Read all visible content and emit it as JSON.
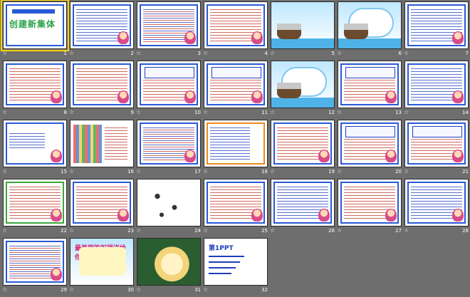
{
  "slides": [
    {
      "num": "1",
      "style": "title",
      "text": "创建新集体"
    },
    {
      "num": "2",
      "style": "text-blue"
    },
    {
      "num": "3",
      "style": "text-mix"
    },
    {
      "num": "4",
      "style": "text-red"
    },
    {
      "num": "5",
      "style": "ship"
    },
    {
      "num": "6",
      "style": "ship-cloud"
    },
    {
      "num": "7",
      "style": "text-blue"
    },
    {
      "num": "8",
      "style": "text-red"
    },
    {
      "num": "9",
      "style": "text-red"
    },
    {
      "num": "10",
      "style": "box-cartoon"
    },
    {
      "num": "11",
      "style": "box-cartoon"
    },
    {
      "num": "12",
      "style": "ship-cloud"
    },
    {
      "num": "13",
      "style": "box-cartoon"
    },
    {
      "num": "14",
      "style": "text-blue"
    },
    {
      "num": "15",
      "style": "cartoon-only"
    },
    {
      "num": "16",
      "style": "people"
    },
    {
      "num": "17",
      "style": "text-mix"
    },
    {
      "num": "18",
      "style": "orange"
    },
    {
      "num": "19",
      "style": "text-red"
    },
    {
      "num": "20",
      "style": "box-cartoon"
    },
    {
      "num": "21",
      "style": "box-cartoon"
    },
    {
      "num": "22",
      "style": "text-green"
    },
    {
      "num": "23",
      "style": "text-red"
    },
    {
      "num": "24",
      "style": "sketch"
    },
    {
      "num": "25",
      "style": "text-red"
    },
    {
      "num": "26",
      "style": "text-blue"
    },
    {
      "num": "27",
      "style": "text-red"
    },
    {
      "num": "28",
      "style": "text-blue"
    },
    {
      "num": "29",
      "style": "text-mix"
    },
    {
      "num": "30",
      "style": "wish",
      "text": "最美丽的祝福送给你！"
    },
    {
      "num": "31",
      "style": "food"
    },
    {
      "num": "32",
      "style": "ppt",
      "text": "第1PPT"
    }
  ],
  "star_glyph": "☆",
  "colors": {
    "background": "#6e6e6e",
    "blue": "#2a59d6",
    "red": "#c0392b",
    "green": "#2aa34a",
    "selection": "#ffd400"
  }
}
